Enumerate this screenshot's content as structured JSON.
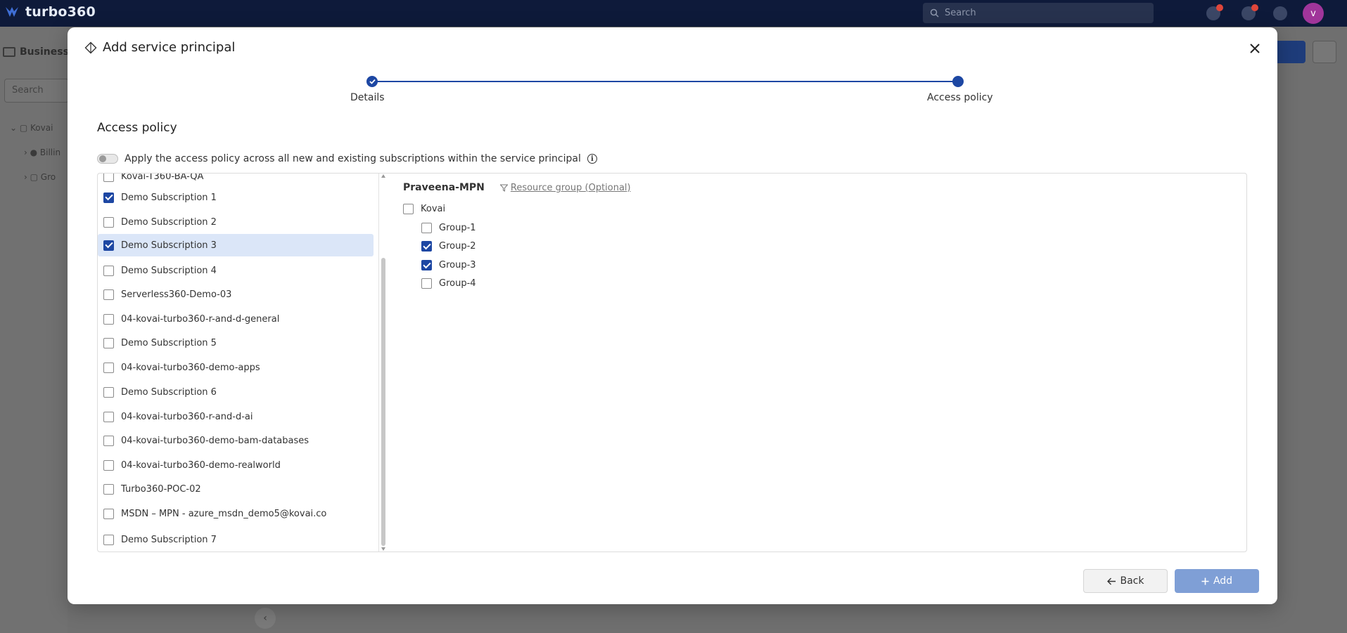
{
  "app": {
    "brand": "turbo360",
    "search_placeholder": "Search",
    "avatar_initial": "v",
    "bg_section_title": "Business",
    "bg_search_placeholder": "Search",
    "bg_tree": [
      "Kovai",
      "Billin",
      "Gro"
    ]
  },
  "modal": {
    "title": "Add service principal",
    "steps": [
      {
        "label": "Details",
        "status": "completed"
      },
      {
        "label": "Access policy",
        "status": "active"
      }
    ],
    "section_title": "Access policy",
    "toggle_label": "Apply the access policy across all new and existing subscriptions within the service principal",
    "toggle_on": false,
    "subscriptions": [
      {
        "label": "Kovai-T360-BA-QA",
        "checked": false,
        "selected": false
      },
      {
        "label": "Demo Subscription 1",
        "checked": true,
        "selected": false
      },
      {
        "label": "Demo Subscription 2",
        "checked": false,
        "selected": false
      },
      {
        "label": "Demo Subscription 3",
        "checked": true,
        "selected": true
      },
      {
        "label": "Demo Subscription 4",
        "checked": false,
        "selected": false
      },
      {
        "label": "Serverless360-Demo-03",
        "checked": false,
        "selected": false
      },
      {
        "label": "04-kovai-turbo360-r-and-d-general",
        "checked": false,
        "selected": false
      },
      {
        "label": "Demo Subscription 5",
        "checked": false,
        "selected": false
      },
      {
        "label": "04-kovai-turbo360-demo-apps",
        "checked": false,
        "selected": false
      },
      {
        "label": "Demo Subscription 6",
        "checked": false,
        "selected": false
      },
      {
        "label": "04-kovai-turbo360-r-and-d-ai",
        "checked": false,
        "selected": false
      },
      {
        "label": "04-kovai-turbo360-demo-bam-databases",
        "checked": false,
        "selected": false
      },
      {
        "label": "04-kovai-turbo360-demo-realworld",
        "checked": false,
        "selected": false
      },
      {
        "label": "Turbo360-POC-02",
        "checked": false,
        "selected": false
      },
      {
        "label": "MSDN – MPN - azure_msdn_demo5@kovai.co",
        "checked": false,
        "selected": false
      },
      {
        "label": "Demo Subscription 7",
        "checked": false,
        "selected": false
      }
    ],
    "detail": {
      "title": "Praveena-MPN",
      "filter_label": "Resource group (Optional)",
      "root": {
        "label": "Kovai",
        "checked": false
      },
      "groups": [
        {
          "label": "Group-1",
          "checked": false
        },
        {
          "label": "Group-2",
          "checked": true
        },
        {
          "label": "Group-3",
          "checked": true
        },
        {
          "label": "Group-4",
          "checked": false
        }
      ]
    },
    "back_label": "Back",
    "add_label": "Add"
  }
}
